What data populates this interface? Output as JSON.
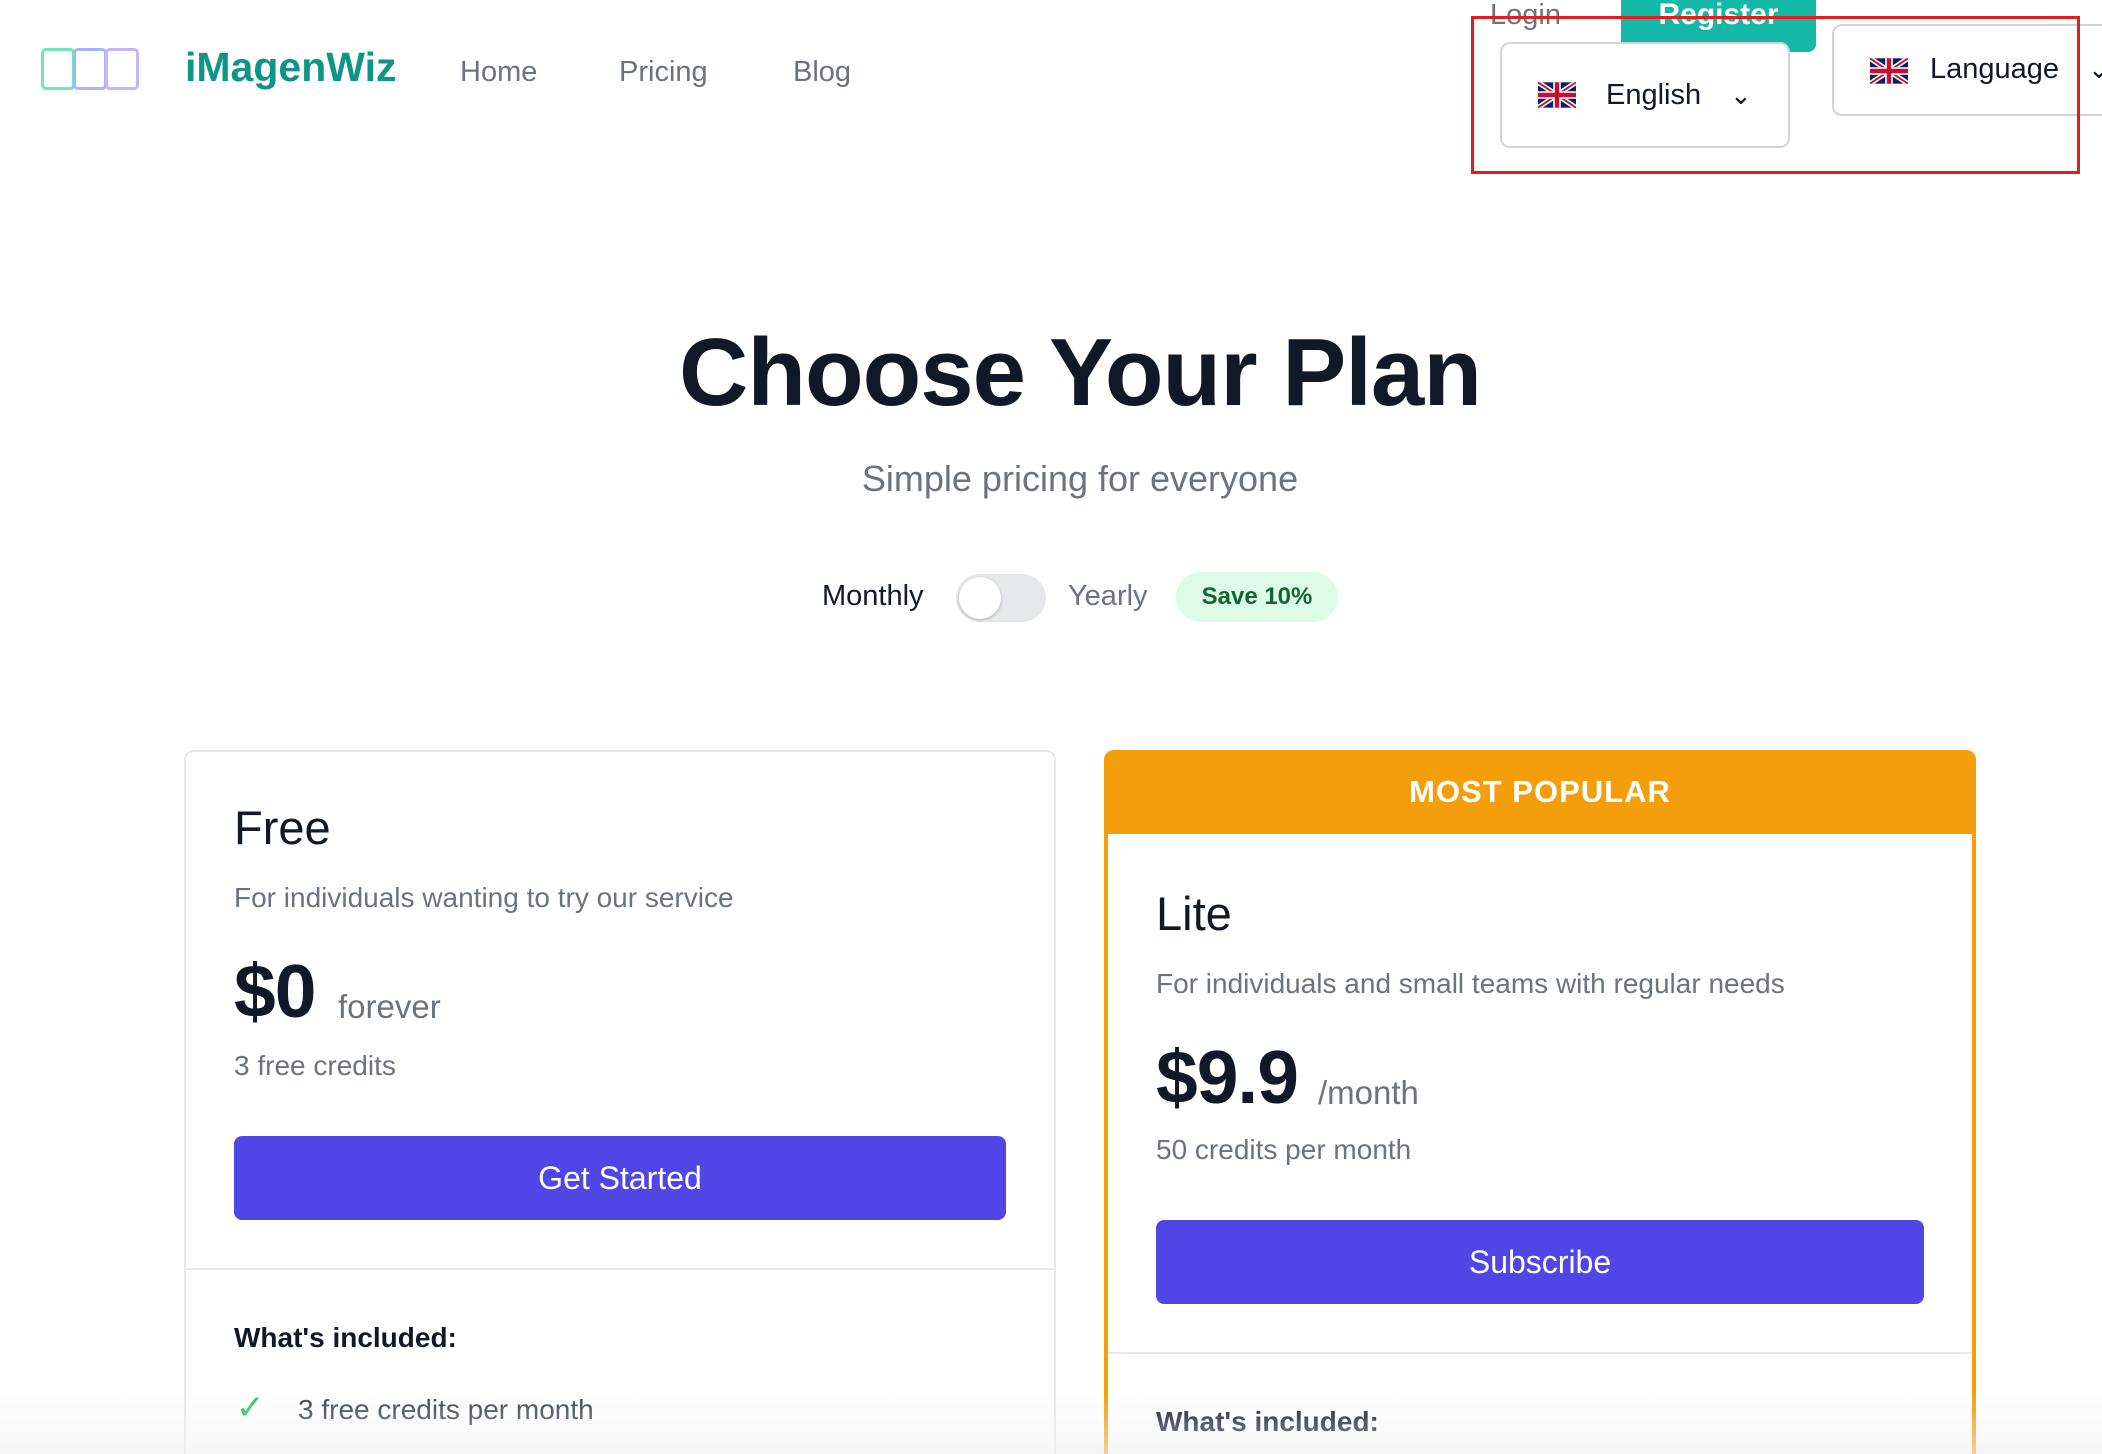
{
  "header": {
    "brand": "iMagenWiz",
    "logo_icon": "panels-logo-icon",
    "nav": [
      {
        "label": "Home"
      },
      {
        "label": "Pricing"
      },
      {
        "label": "Blog"
      }
    ],
    "login_label": "Login",
    "register_label": "Register",
    "language_select": {
      "flag_icon": "uk-flag-icon",
      "value": "English",
      "chevron_icon": "chevron-down-icon"
    },
    "language_select_secondary": {
      "flag_icon": "uk-flag-icon",
      "value": "Language",
      "chevron_icon": "chevron-down-icon"
    },
    "highlight_color": "#e11d1d"
  },
  "hero": {
    "title": "Choose Your Plan",
    "subtitle": "Simple pricing for everyone"
  },
  "billing_toggle": {
    "monthly_label": "Monthly",
    "yearly_label": "Yearly",
    "save_badge": "Save 10%",
    "yearly_selected": false
  },
  "plans": [
    {
      "name": "Free",
      "description": "For individuals wanting to try our service",
      "price": "$0",
      "period": "forever",
      "credits": "3 free credits",
      "button": "Get Started",
      "included_heading": "What's included:",
      "features": [
        {
          "icon": "check-icon",
          "text": "3 free credits per month"
        }
      ]
    },
    {
      "badge": "MOST POPULAR",
      "name": "Lite",
      "description": "For individuals and small teams with regular needs",
      "price": "$9.9",
      "period": "/month",
      "credits": "50 credits per month",
      "button": "Subscribe",
      "included_heading": "What's included:"
    }
  ],
  "colors": {
    "brand": "#0f9488",
    "primary_button": "#4f46e5",
    "popular": "#f59e0b",
    "register": "#14b8a6",
    "save_badge_bg": "#dcfce7",
    "save_badge_text": "#166534"
  }
}
